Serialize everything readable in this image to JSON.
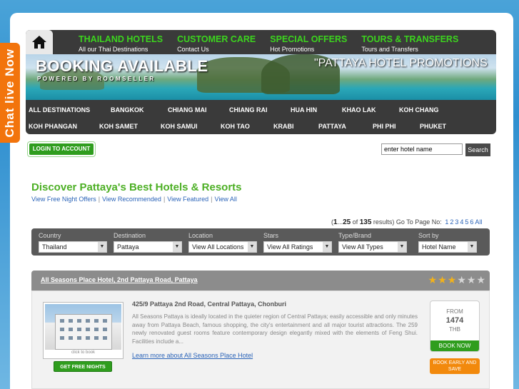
{
  "chat_tab": {
    "label": "Chat live Now"
  },
  "header": {
    "home_icon": "home-icon",
    "topnav": [
      {
        "title": "THAILAND HOTELS",
        "sub": "All our Thai Destinations"
      },
      {
        "title": "CUSTOMER CARE",
        "sub": "Contact Us"
      },
      {
        "title": "SPECIAL OFFERS",
        "sub": "Hot Promotions"
      },
      {
        "title": "TOURS & TRANSFERS",
        "sub": "Tours and Transfers"
      }
    ],
    "brand": "BOOKING AVAILABLE",
    "powered": "POWERED BY ROOMSELLER",
    "promo": "\"PATTAYA HOTEL PROMOTIONS"
  },
  "destinations_row1": [
    "ALL DESTINATIONS",
    "BANGKOK",
    "CHIANG MAI",
    "CHIANG RAI",
    "HUA HIN",
    "KHAO LAK",
    "KOH CHANG"
  ],
  "destinations_row2": [
    "KOH PHANGAN",
    "KOH SAMET",
    "KOH SAMUI",
    "KOH TAO",
    "KRABI",
    "PATTAYA",
    "PHI PHI",
    "PHUKET"
  ],
  "login": {
    "label": "LOGIN TO ACCOUNT"
  },
  "search": {
    "value": "enter hotel name",
    "button": "Search"
  },
  "main": {
    "title": "Discover Pattaya's Best Hotels & Resorts",
    "links": [
      "View Free Night Offers",
      "View Recommended",
      "View Featured",
      "View All"
    ],
    "results": {
      "open": "(",
      "first": "1",
      "range_sep": "...",
      "last": "25",
      "of": " of ",
      "total": "135",
      "suffix": " results) Go To Page No:",
      "pages": [
        "1",
        "2",
        "3",
        "4",
        "5",
        "6",
        "All"
      ]
    }
  },
  "filters": [
    {
      "label": "Country",
      "value": "Thailand"
    },
    {
      "label": "Destination",
      "value": "Pattaya"
    },
    {
      "label": "Location",
      "value": "View All Locations"
    },
    {
      "label": "Stars",
      "value": "View All Ratings"
    },
    {
      "label": "Type/Brand",
      "value": "View All Types"
    },
    {
      "label": "Sort by",
      "value": "Hotel Name"
    }
  ],
  "hotel": {
    "name": "All Seasons Place Hotel, 2nd Pattaya Road, Pattaya",
    "stars": 3,
    "stars_max": 6,
    "photo_caption": "click to book",
    "free_nights": "GET FREE NIGHTS",
    "address": "425/9 Pattaya 2nd Road, Central Pattaya, Chonburi",
    "description": "All Seasons Pattaya is ideally located in the quieter region of Central Pattaya; easily accessible and only minutes away from Pattaya Beach, famous shopping, the city's entertainment and all major tourist attractions. The 259 newly renovated guest rooms feature contemporary design elegantly mixed with the elements of Feng Shui. Facilities include a...",
    "more_link": "Learn more about All Seasons Place Hotel",
    "price_from": "FROM",
    "price": "1474",
    "currency": "THB",
    "book_now": "BOOK NOW",
    "book_early": "BOOK EARLY AND SAVE"
  },
  "colors": {
    "green": "#3cd41e",
    "title_green": "#4caf24",
    "link_blue": "#2a63b8",
    "orange": "#f2740c",
    "star_gold": "#f2b21a"
  }
}
